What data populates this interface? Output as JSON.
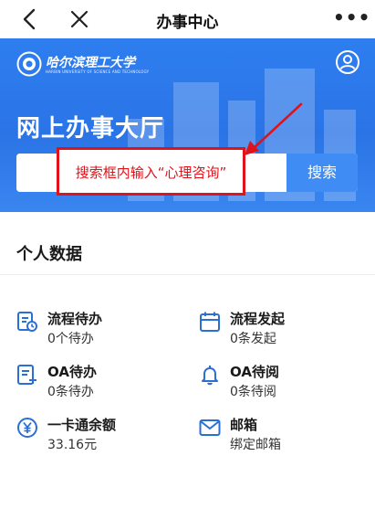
{
  "nav": {
    "title": "办事中心",
    "more_label": "•••"
  },
  "hero": {
    "university_name": "哈尔滨理工大学",
    "university_subtitle": "HARBIN UNIVERSITY OF SCIENCE AND TECHNOLOGY",
    "title": "网上办事大厅",
    "search_placeholder": "",
    "search_button": "搜索"
  },
  "annotation": {
    "text": "搜索框内输入“心理咨询”",
    "color": "#e0131b"
  },
  "personal": {
    "section_title": "个人数据",
    "items": [
      {
        "title": "流程待办",
        "sub": "0个待办",
        "icon": "process-todo-icon"
      },
      {
        "title": "流程发起",
        "sub": "0条发起",
        "icon": "calendar-icon"
      },
      {
        "title": "OA待办",
        "sub": "0条待办",
        "icon": "document-add-icon"
      },
      {
        "title": "OA待阅",
        "sub": "0条待阅",
        "icon": "bell-icon"
      },
      {
        "title": "一卡通余额",
        "sub": "33.16元",
        "icon": "yuan-icon"
      },
      {
        "title": "邮箱",
        "sub": "绑定邮箱",
        "icon": "mail-icon"
      }
    ]
  },
  "colors": {
    "brand_blue": "#2e7ef0",
    "icon_blue": "#2a6fd6",
    "annotation_red": "#e0131b"
  }
}
